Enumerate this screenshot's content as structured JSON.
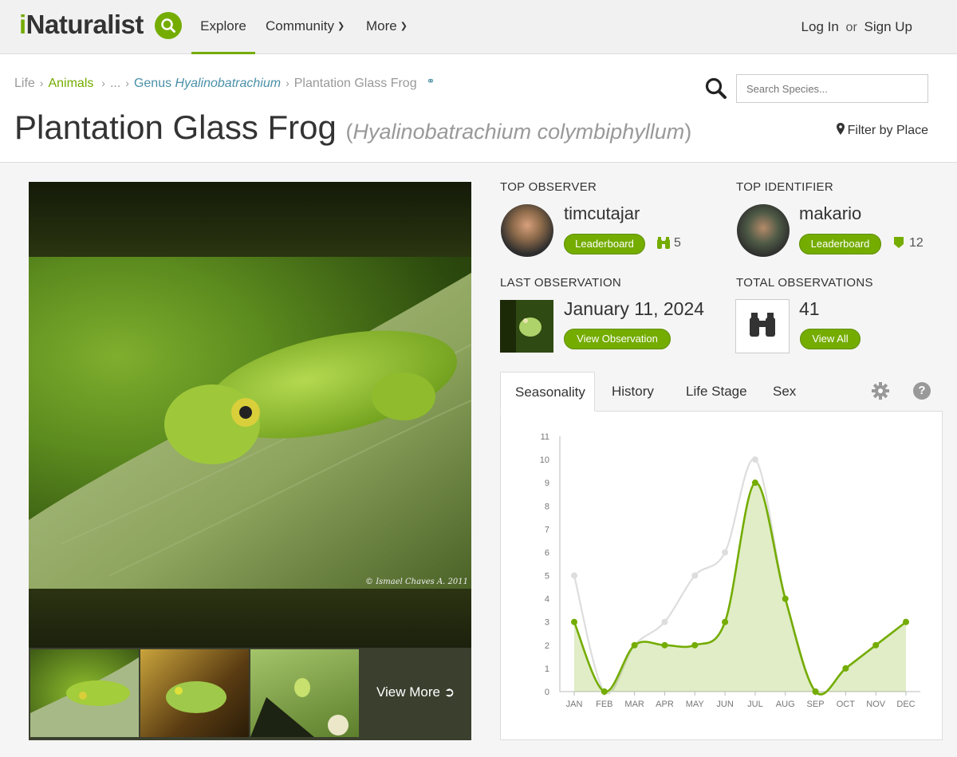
{
  "nav": {
    "logo_i": "i",
    "logo_rest": "Naturalist",
    "explore": "Explore",
    "community": "Community",
    "more": "More",
    "login": "Log In",
    "or": "or",
    "signup": "Sign Up"
  },
  "breadcrumbs": {
    "life": "Life",
    "animals": "Animals",
    "ellipsis": "...",
    "genus_prefix": "Genus",
    "genus_name": "Hyalinobatrachium",
    "current": "Plantation Glass Frog"
  },
  "search": {
    "placeholder": "Search Species..."
  },
  "taxon": {
    "common_name": "Plantation Glass Frog",
    "sci_open": "(",
    "scientific_name": "Hyalinobatrachium colymbiphyllum",
    "sci_close": ")",
    "filter_label": "Filter by Place"
  },
  "photo": {
    "copyright": "© Ismael Chaves A. 2011",
    "view_more": "View More"
  },
  "top_observer": {
    "label": "TOP OBSERVER",
    "name": "timcutajar",
    "leaderboard": "Leaderboard",
    "count": "5"
  },
  "top_identifier": {
    "label": "TOP IDENTIFIER",
    "name": "makario",
    "leaderboard": "Leaderboard",
    "count": "12"
  },
  "last_observation": {
    "label": "LAST OBSERVATION",
    "date": "January 11, 2024",
    "button": "View Observation"
  },
  "total_observations": {
    "label": "TOTAL OBSERVATIONS",
    "count": "41",
    "button": "View All"
  },
  "tabs": [
    {
      "label": "Seasonality",
      "active": true
    },
    {
      "label": "History",
      "active": false
    },
    {
      "label": "Life Stage",
      "active": false
    },
    {
      "label": "Sex",
      "active": false
    }
  ],
  "colors": {
    "accent": "#74ac00",
    "comparison_line": "#dddddd"
  },
  "chart_data": {
    "type": "line",
    "categories": [
      "JAN",
      "FEB",
      "MAR",
      "APR",
      "MAY",
      "JUN",
      "JUL",
      "AUG",
      "SEP",
      "OCT",
      "NOV",
      "DEC"
    ],
    "series": [
      {
        "values": [
          5,
          0,
          2,
          3,
          5,
          6,
          10,
          4,
          0,
          1,
          2,
          3
        ],
        "color": "#dddddd"
      },
      {
        "values": [
          3,
          0,
          2,
          2,
          2,
          3,
          9,
          4,
          0,
          1,
          2,
          3
        ],
        "color": "#74ac00"
      }
    ],
    "ylim": [
      0,
      11
    ],
    "yticks": [
      "0",
      "1",
      "2",
      "3",
      "4",
      "5",
      "6",
      "7",
      "8",
      "9",
      "10",
      "11"
    ],
    "xlabel": "",
    "ylabel": ""
  }
}
